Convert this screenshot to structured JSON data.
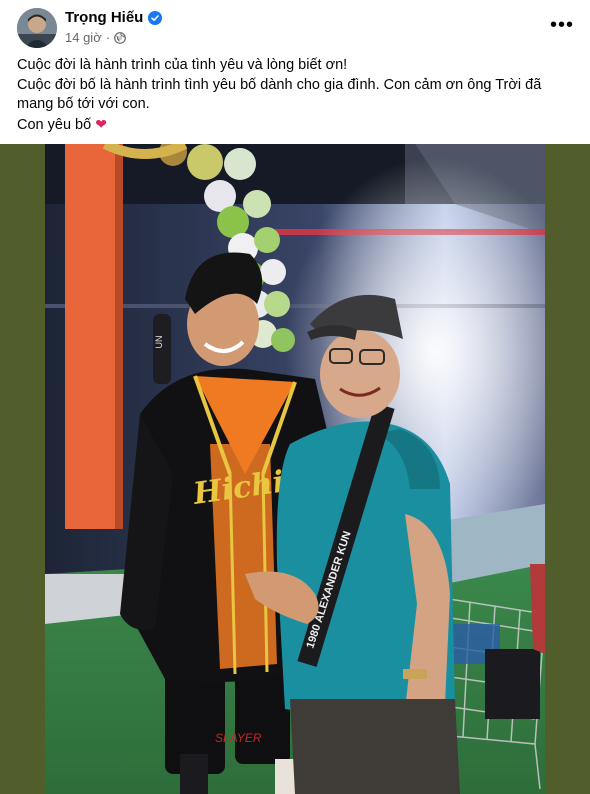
{
  "post": {
    "author_name": "Trọng Hiếu",
    "verified_icon": "verified-badge-icon",
    "timestamp": "14 giờ",
    "separator": "·",
    "audience_icon": "globe-icon",
    "more_icon": "more-options-icon",
    "more_label": "•••",
    "caption_lines": [
      "Cuộc đời là hành trình của tình yêu và lòng biết ơn!",
      "Cuộc đời bố là hành trình tình yêu bố dành cho gia đình. Con cảm ơn ông Trời đã",
      "mang bố tới với con.",
      "Con yêu bố"
    ],
    "caption_emoji": "❤",
    "photo": {
      "shirt_text": "1980 ALEXANDER KUN",
      "jersey_text": "Hichie",
      "bag_text": "UN",
      "shorts_text": "SLAYER"
    }
  },
  "colors": {
    "frame_background": "#515e2b",
    "verified_blue": "#1877f2",
    "meta_gray": "#65676b",
    "heart_red": "#e0245e",
    "teal_shirt": "#1a8fa0",
    "orange_pillar": "#e8663a"
  }
}
